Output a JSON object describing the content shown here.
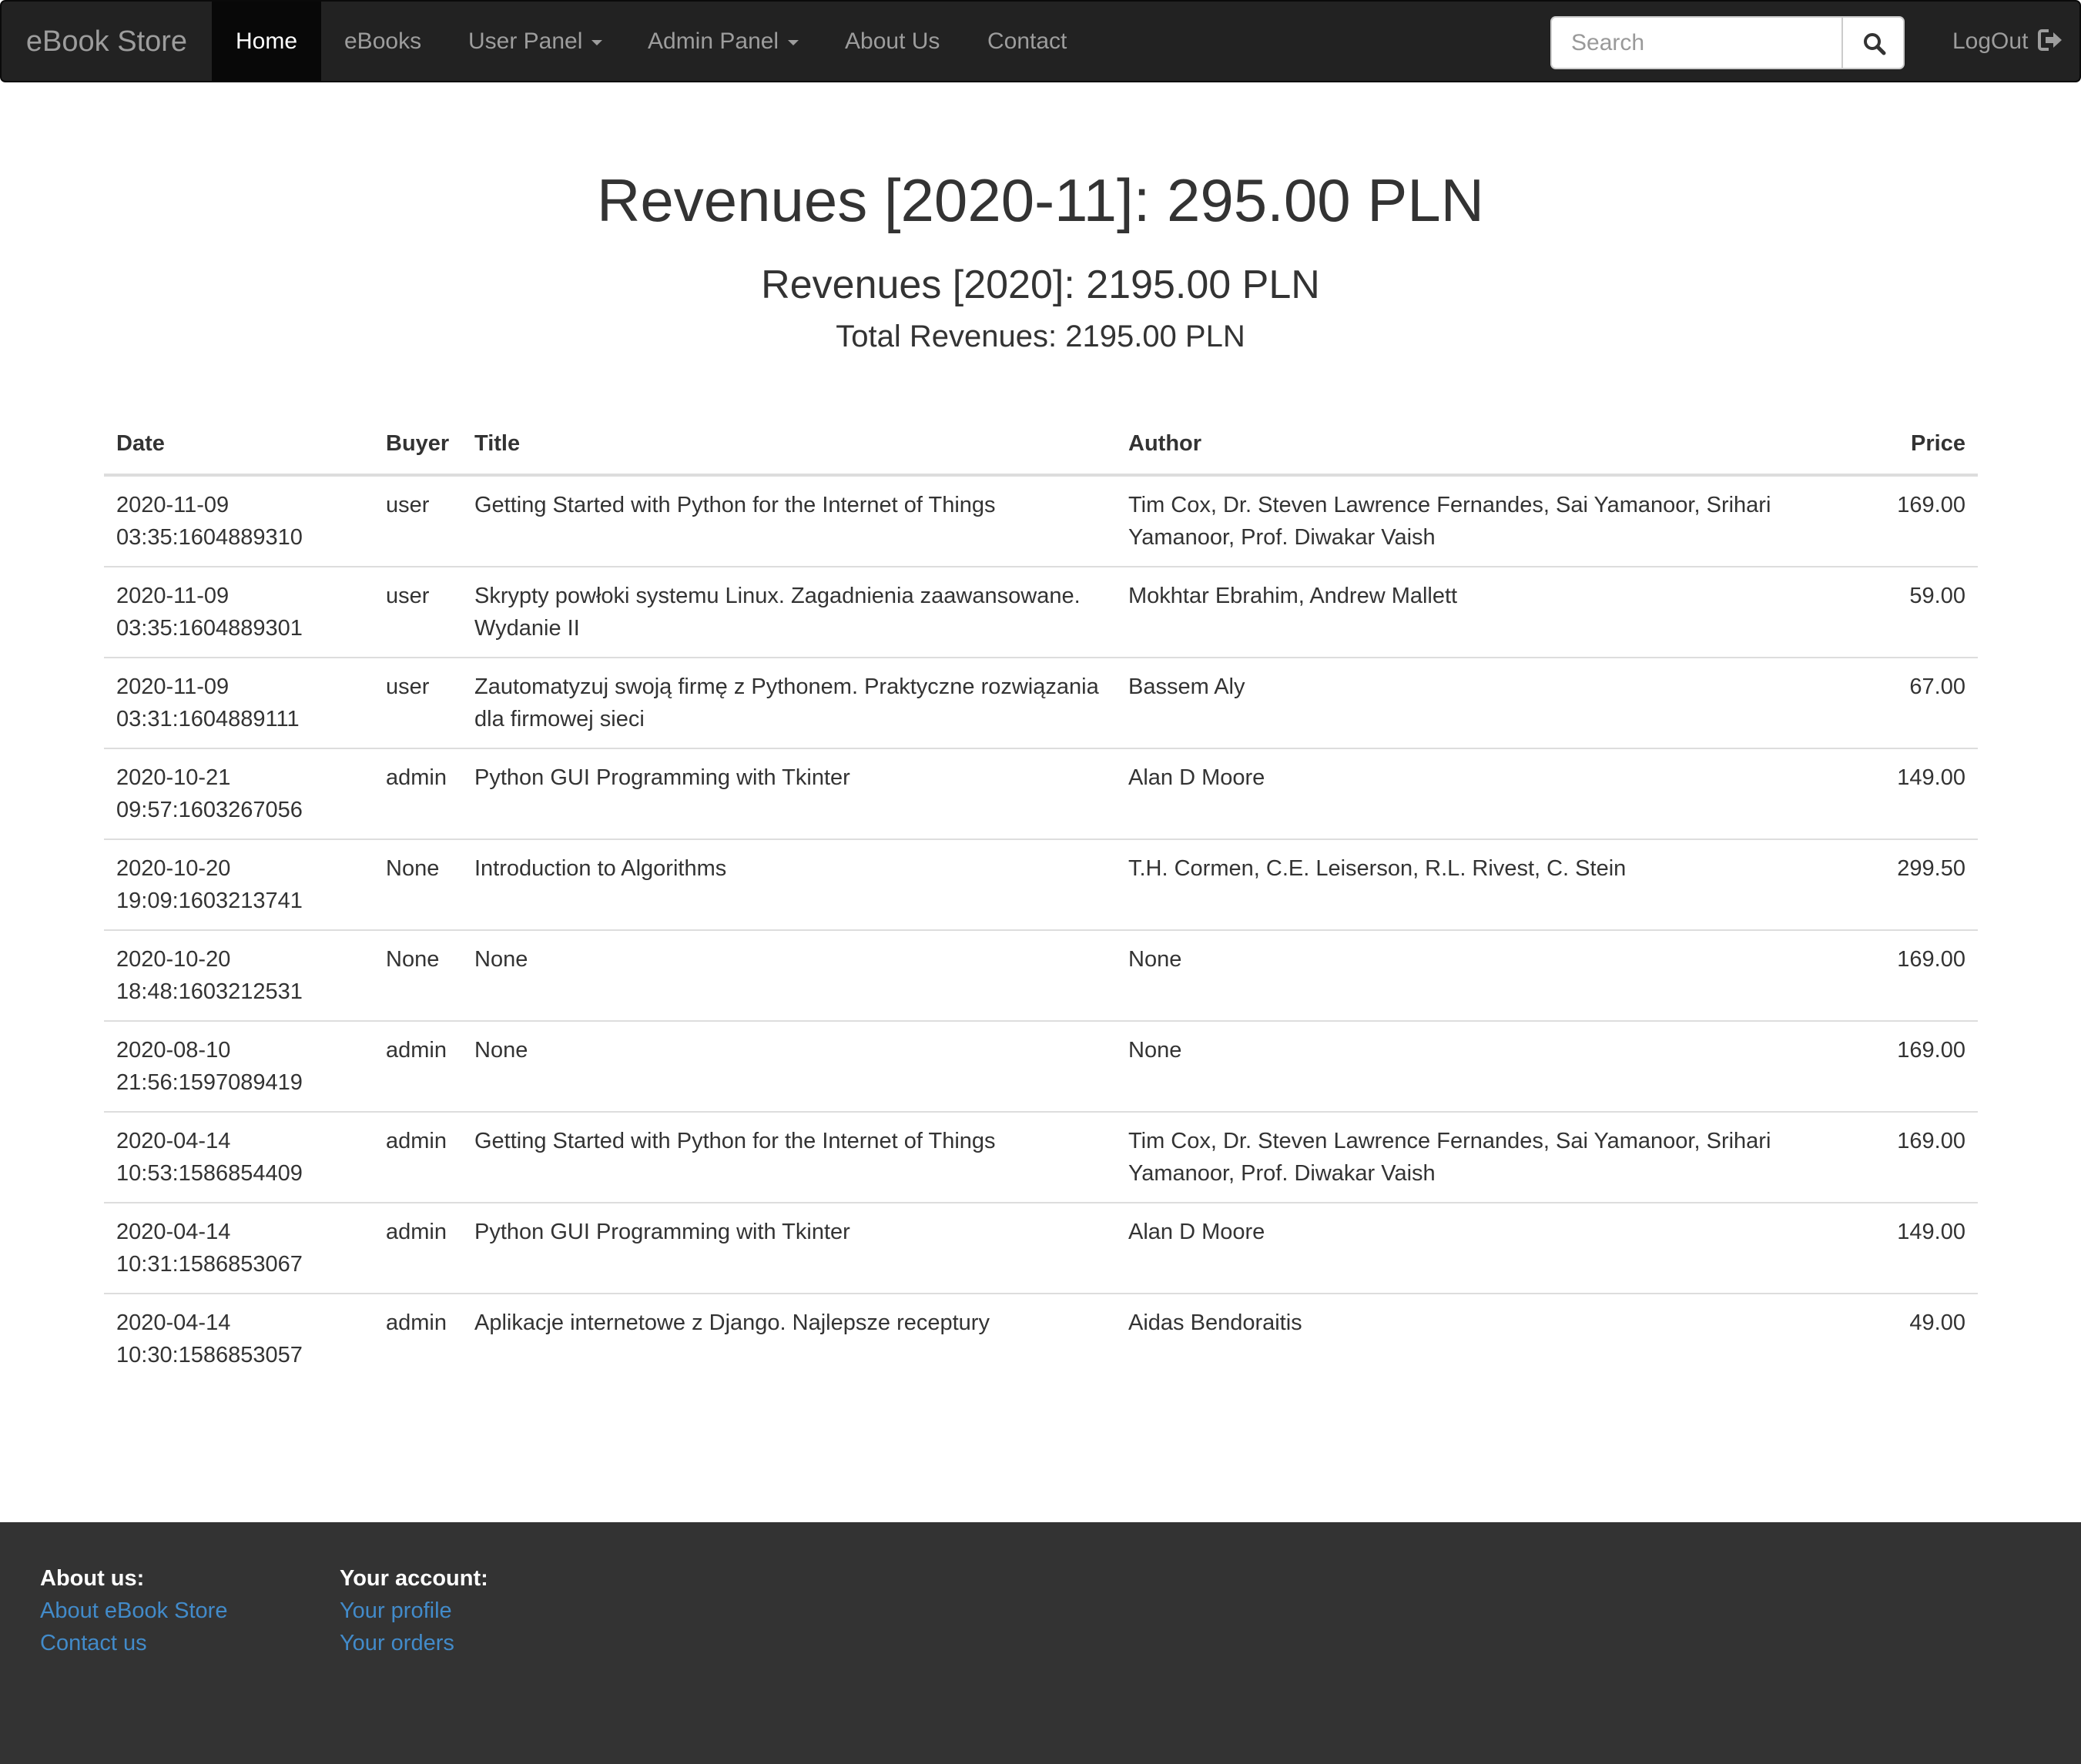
{
  "navbar": {
    "brand": "eBook Store",
    "items": [
      {
        "label": "Home"
      },
      {
        "label": "eBooks"
      },
      {
        "label": "User Panel"
      },
      {
        "label": "Admin Panel"
      },
      {
        "label": "About Us"
      },
      {
        "label": "Contact"
      }
    ],
    "search": {
      "placeholder": "Search",
      "value": ""
    },
    "logout_label": "LogOut",
    "icons": {
      "search": "search-icon",
      "logout": "logout-icon",
      "dropdown": "caret-down-icon"
    },
    "colors": {
      "background": "#222222",
      "active_background": "#080808",
      "text": "#9d9d9d",
      "active_text": "#ffffff"
    }
  },
  "headings": {
    "month_revenue": "Revenues [2020-11]: 295.00 PLN",
    "year_revenue": "Revenues [2020]: 2195.00 PLN",
    "total_revenue": "Total Revenues: 2195.00 PLN"
  },
  "table": {
    "columns": [
      "Date",
      "Buyer",
      "Title",
      "Author",
      "Price"
    ],
    "rows": [
      {
        "date": "2020-11-09 03:35:1604889310",
        "buyer": "user",
        "title": "Getting Started with Python for the Internet of Things",
        "author": "Tim Cox, Dr. Steven Lawrence Fernandes, Sai Yamanoor, Srihari Yamanoor, Prof. Diwakar Vaish",
        "price": "169.00"
      },
      {
        "date": "2020-11-09 03:35:1604889301",
        "buyer": "user",
        "title": "Skrypty powłoki systemu Linux. Zagadnienia zaawansowane. Wydanie II",
        "author": "Mokhtar Ebrahim, Andrew Mallett",
        "price": "59.00"
      },
      {
        "date": "2020-11-09 03:31:1604889111",
        "buyer": "user",
        "title": "Zautomatyzuj swoją firmę z Pythonem. Praktyczne rozwiązania dla firmowej sieci",
        "author": "Bassem Aly",
        "price": "67.00"
      },
      {
        "date": "2020-10-21 09:57:1603267056",
        "buyer": "admin",
        "title": "Python GUI Programming with Tkinter",
        "author": "Alan D Moore",
        "price": "149.00"
      },
      {
        "date": "2020-10-20 19:09:1603213741",
        "buyer": "None",
        "title": "Introduction to Algorithms",
        "author": "T.H. Cormen, C.E. Leiserson, R.L. Rivest, C. Stein",
        "price": "299.50"
      },
      {
        "date": "2020-10-20 18:48:1603212531",
        "buyer": "None",
        "title": "None",
        "author": "None",
        "price": "169.00"
      },
      {
        "date": "2020-08-10 21:56:1597089419",
        "buyer": "admin",
        "title": "None",
        "author": "None",
        "price": "169.00"
      },
      {
        "date": "2020-04-14 10:53:1586854409",
        "buyer": "admin",
        "title": "Getting Started with Python for the Internet of Things",
        "author": "Tim Cox, Dr. Steven Lawrence Fernandes, Sai Yamanoor, Srihari Yamanoor, Prof. Diwakar Vaish",
        "price": "169.00"
      },
      {
        "date": "2020-04-14 10:31:1586853067",
        "buyer": "admin",
        "title": "Python GUI Programming with Tkinter",
        "author": "Alan D Moore",
        "price": "149.00"
      },
      {
        "date": "2020-04-14 10:30:1586853057",
        "buyer": "admin",
        "title": "Aplikacje internetowe z Django. Najlepsze receptury",
        "author": "Aidas Bendoraitis",
        "price": "49.00"
      }
    ]
  },
  "footer": {
    "about": {
      "heading": "About us:",
      "links": [
        "About eBook Store",
        "Contact us"
      ]
    },
    "account": {
      "heading": "Your account:",
      "links": [
        "Your profile",
        "Your orders"
      ]
    },
    "colors": {
      "background": "#333333",
      "link": "#428bca"
    }
  }
}
